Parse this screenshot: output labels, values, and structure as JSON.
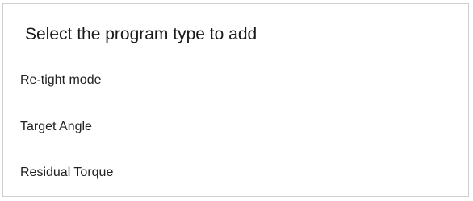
{
  "dialog": {
    "title": "Select the program type to add",
    "options": [
      {
        "label": "Re-tight mode"
      },
      {
        "label": "Target Angle"
      },
      {
        "label": "Residual Torque"
      }
    ]
  }
}
